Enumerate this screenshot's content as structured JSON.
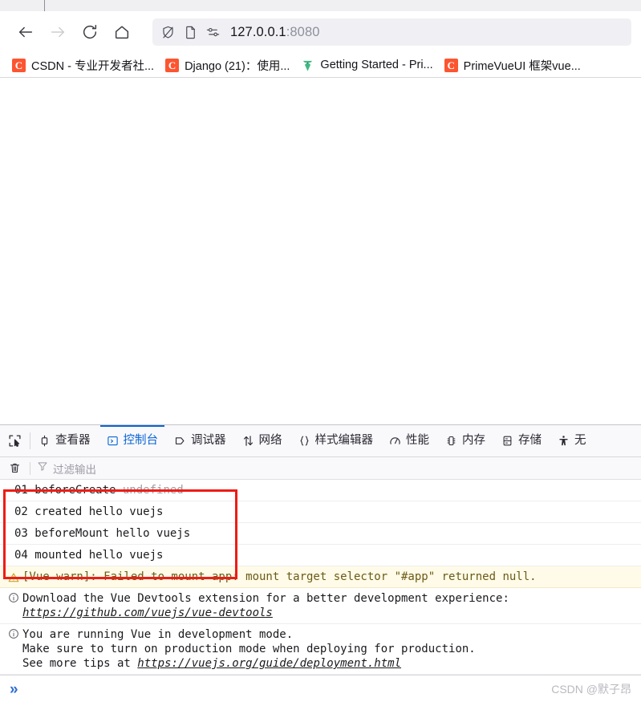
{
  "browser": {
    "nav": {
      "back_label": "Back",
      "forward_label": "Forward",
      "reload_label": "Reload",
      "home_label": "Home"
    },
    "urlbar": {
      "host": "127.0.0.1",
      "port": ":8080",
      "shield_icon": "shield-off-icon",
      "reader_icon": "page-icon",
      "settings_icon": "tracking-settings-icon"
    },
    "bookmarks": [
      {
        "label": "CSDN - 专业开发者社...",
        "favicon": "csdn-favicon",
        "favicon_text": "C"
      },
      {
        "label": "Django (21)：使用...",
        "favicon": "csdn-favicon",
        "favicon_text": "C"
      },
      {
        "label": "Getting Started - Pri...",
        "favicon": "primevue-favicon",
        "favicon_text": ""
      },
      {
        "label": "PrimeVueUI 框架vue...",
        "favicon": "csdn-favicon",
        "favicon_text": "C"
      }
    ]
  },
  "devtools": {
    "picker_icon": "element-picker-icon",
    "tabs": [
      {
        "label": "查看器",
        "icon": "inspector-icon",
        "active": false
      },
      {
        "label": "控制台",
        "icon": "console-icon",
        "active": true
      },
      {
        "label": "调试器",
        "icon": "debugger-icon",
        "active": false
      },
      {
        "label": "网络",
        "icon": "network-icon",
        "active": false
      },
      {
        "label": "样式编辑器",
        "icon": "style-editor-icon",
        "active": false
      },
      {
        "label": "性能",
        "icon": "performance-icon",
        "active": false
      },
      {
        "label": "内存",
        "icon": "memory-icon",
        "active": false
      },
      {
        "label": "存储",
        "icon": "storage-icon",
        "active": false
      },
      {
        "label": "无",
        "icon": "accessibility-icon",
        "active": false
      }
    ],
    "filterbar": {
      "clear_icon": "trash-icon",
      "filter_icon": "funnel-icon",
      "filter_placeholder": "过滤输出",
      "filter_value": ""
    },
    "logs": [
      {
        "type": "log",
        "num": "01",
        "text": "beforeCreate ",
        "dim": "undefined"
      },
      {
        "type": "log",
        "num": "02",
        "text": "created hello vuejs",
        "dim": ""
      },
      {
        "type": "log",
        "num": "03",
        "text": "beforeMount hello vuejs",
        "dim": ""
      },
      {
        "type": "log",
        "num": "04",
        "text": "mounted hello vuejs",
        "dim": ""
      }
    ],
    "warning": {
      "icon": "warning-triangle-icon",
      "text": "[Vue warn]: Failed to mount app: mount target selector \"#app\" returned null."
    },
    "info_rows": [
      {
        "icon": "info-circle-icon",
        "line1": "Download the Vue Devtools extension for a better development experience:",
        "link": "https://github.com/vuejs/vue-devtools",
        "line3": ""
      },
      {
        "icon": "info-circle-icon",
        "line1": "You are running Vue in development mode.",
        "line2": "Make sure to turn on production mode when deploying for production.",
        "line3_prefix": "See more tips at ",
        "link": "https://vuejs.org/guide/deployment.html"
      }
    ],
    "statusbar": {
      "prompt": "»",
      "watermark": "CSDN @默子昂"
    },
    "highlight_color": "#ee1c16",
    "accent_color": "#0a65d6"
  }
}
